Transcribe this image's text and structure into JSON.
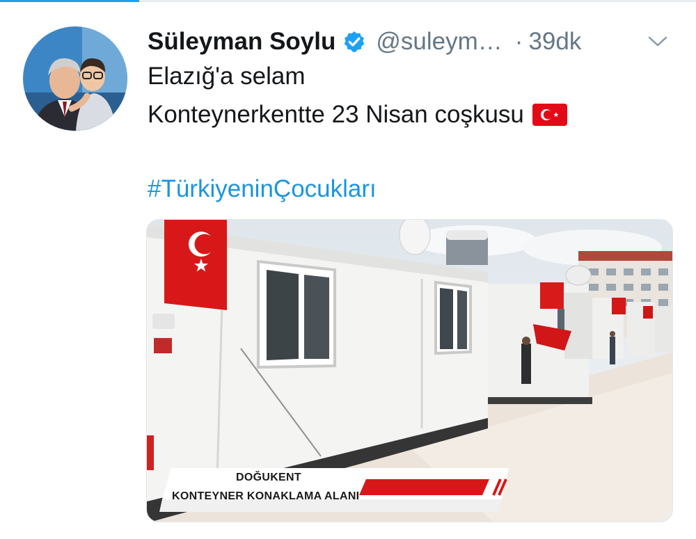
{
  "tweet": {
    "author_name": "Süleyman Soylu",
    "handle": "@suleym…",
    "separator": "·",
    "timestamp": "39dk",
    "text_line1": "Elazığ'a selam",
    "text_line2": "Konteynerkentte 23 Nisan coşkusu",
    "hashtag": "#TürkiyeninÇocukları",
    "verified_icon": "verified-badge-icon",
    "flag_icon": "turkey-flag-icon",
    "menu_icon": "chevron-down-icon"
  },
  "media": {
    "caption_line1": "DOĞUKENT",
    "caption_line2": "KONTEYNER KONAKLAMA ALANI"
  },
  "colors": {
    "accent": "#1da1f2",
    "hashtag": "#1b95e0",
    "muted": "#657786",
    "text": "#14171a",
    "flag_red": "#e30a17"
  }
}
